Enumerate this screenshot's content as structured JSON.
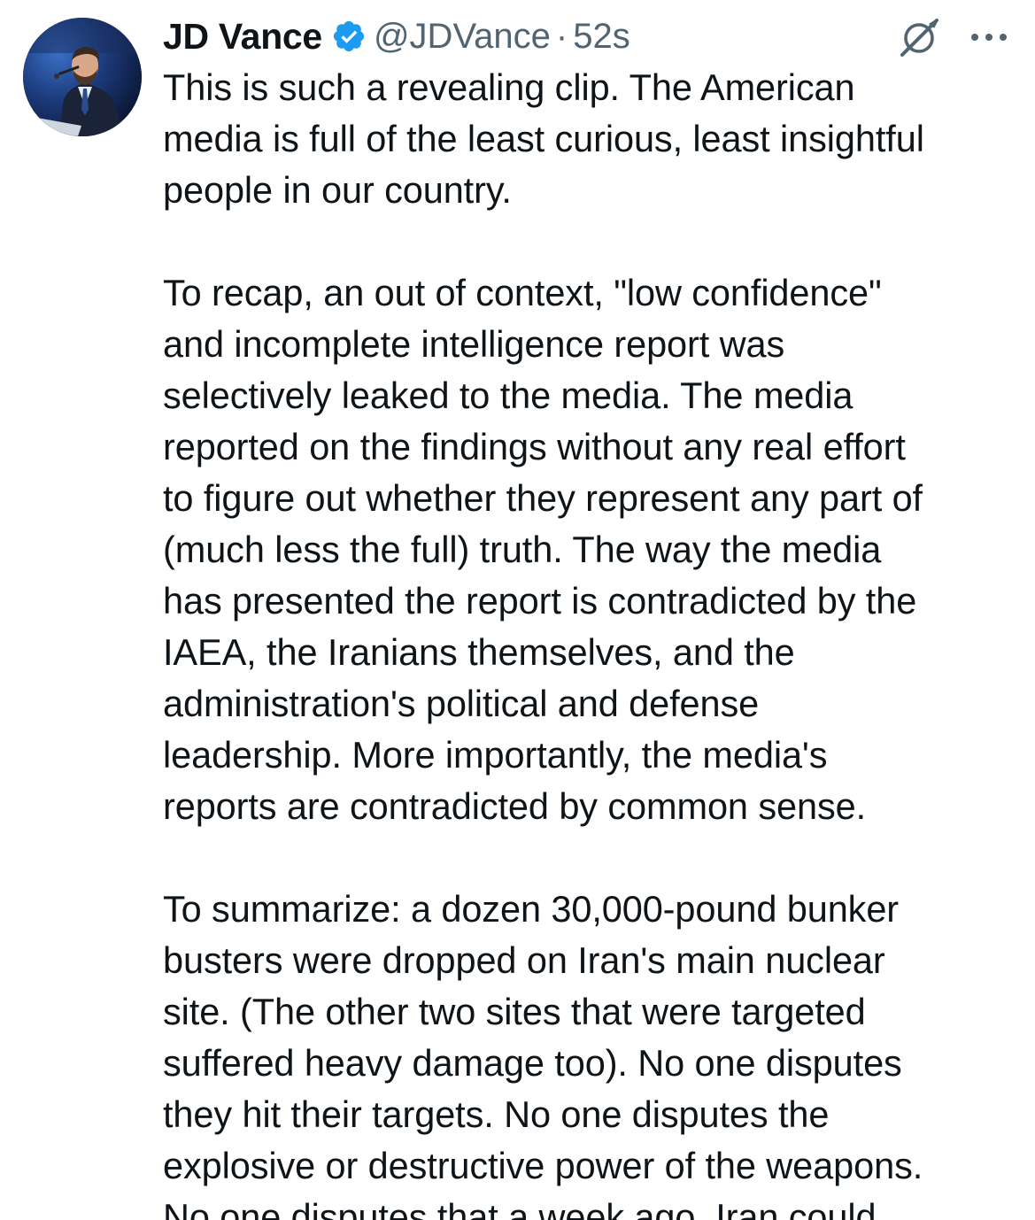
{
  "tweet": {
    "display_name": "JD Vance",
    "handle": "@JDVance",
    "separator": "·",
    "time": "52s",
    "verified_icon": "verified-badge-icon",
    "action_icons": [
      "grok-icon",
      "more-options-icon"
    ],
    "colors": {
      "verified": "#1d9bf0",
      "text": "#0f1419",
      "muted": "#536471"
    },
    "paragraphs": [
      {
        "lines": [
          "This is such a revealing clip. The American",
          "media is full of the least curious, least insightful",
          "people in our country."
        ]
      },
      {
        "lines": [
          "To recap, an out of context, \"low confidence\"",
          "and incomplete intelligence report was",
          "selectively leaked to the media. The media",
          "reported on the findings without any real effort",
          "to figure out whether they represent any part of",
          "(much less the full) truth. The way the media",
          "has presented the report is contradicted by the",
          "IAEA, the Iranians themselves, and the",
          "administration's political and defense",
          "leadership. More importantly, the media's",
          "reports are contradicted by common sense."
        ]
      },
      {
        "lines": [
          "To summarize: a dozen 30,000-pound bunker",
          "busters were dropped on Iran's main nuclear",
          "site. (The other two sites that were targeted",
          "suffered heavy damage too). No one disputes",
          "they hit their targets. No one disputes the",
          "explosive or destructive power of the weapons.",
          "No one disputes that a week ago, Iran could"
        ]
      }
    ]
  }
}
